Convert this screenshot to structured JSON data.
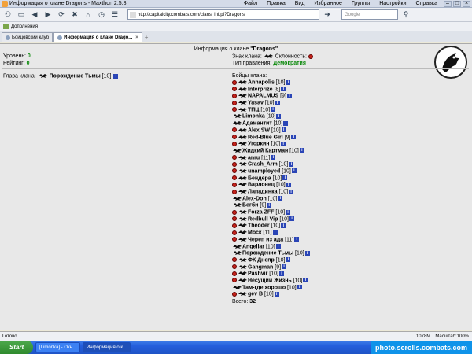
{
  "window": {
    "title": "Информация о клане Dragons - Maxthon 2.5.8",
    "menu": [
      "Файл",
      "Правка",
      "Вид",
      "Избранное",
      "Группы",
      "Настройки",
      "Справка"
    ]
  },
  "toolbar": {
    "address": "http://capitalcity.combats.com/clans_inf.pl?Dragons",
    "search_placeholder": "Google"
  },
  "addons": {
    "label": "Дополнения"
  },
  "tabs": [
    {
      "label": "Бойцовский клуб",
      "active": false
    },
    {
      "label": "Информация о клане Drago...",
      "active": true
    }
  ],
  "clan": {
    "header_prefix": "Информация о клане",
    "name": "\"Dragons\"",
    "level_label": "Уровень:",
    "level": "0",
    "rating_label": "Рейтинг:",
    "rating": "0",
    "sign_label": "Знак клана:",
    "alignment_label": "Склонность:",
    "government_label": "Тип правления:",
    "government": "Демократия",
    "head_label": "Глава клана:",
    "head_name": "Порождение Тьмы",
    "head_level": "[10]",
    "fighters_label": "Бойцы клана:",
    "total_label": "Всего:",
    "total": "32"
  },
  "members": [
    {
      "name": "Annapolis",
      "level": "[10]",
      "emblem": true
    },
    {
      "name": "Interprize",
      "level": "[8]",
      "emblem": true
    },
    {
      "name": "NAPALMUS",
      "level": "[9]",
      "emblem": true
    },
    {
      "name": "Yasav",
      "level": "[10]",
      "emblem": true
    },
    {
      "name": "TПЦ",
      "level": "[10]",
      "emblem": true
    },
    {
      "name": "Limonka",
      "level": "[10]",
      "emblem": false
    },
    {
      "name": "Адамантит",
      "level": "[10]",
      "emblem": false
    },
    {
      "name": "Alex SW",
      "level": "[10]",
      "emblem": true
    },
    {
      "name": "Red-Blue Girl",
      "level": "[9]",
      "emblem": true
    },
    {
      "name": "Угоркин",
      "level": "[10]",
      "emblem": true
    },
    {
      "name": "Жидкий Картман",
      "level": "[10]",
      "emblem": false
    },
    {
      "name": "anru",
      "level": "[11]",
      "emblem": true
    },
    {
      "name": "Crash_Arm",
      "level": "[10]",
      "emblem": true
    },
    {
      "name": "unamployed",
      "level": "[10]",
      "emblem": true
    },
    {
      "name": "Бендера",
      "level": "[10]",
      "emblem": true
    },
    {
      "name": "Варлонец",
      "level": "[10]",
      "emblem": true
    },
    {
      "name": "Лападинка",
      "level": "[10]",
      "emblem": true
    },
    {
      "name": "Alex-Don",
      "level": "[10]",
      "emblem": false
    },
    {
      "name": "Бегби",
      "level": "[9]",
      "emblem": false
    },
    {
      "name": "Forza ZFF",
      "level": "[10]",
      "emblem": true
    },
    {
      "name": "Redbull Vip",
      "level": "[10]",
      "emblem": true
    },
    {
      "name": "Theoder",
      "level": "[10]",
      "emblem": true
    },
    {
      "name": "Моск",
      "level": "[11]",
      "emblem": true
    },
    {
      "name": "Череп из ада",
      "level": "[11]",
      "emblem": true
    },
    {
      "name": "Angellar",
      "level": "[10]",
      "emblem": false
    },
    {
      "name": "Порождение Тьмы",
      "level": "[10]",
      "emblem": false
    },
    {
      "name": "ФК Днепр",
      "level": "[10]",
      "emblem": true
    },
    {
      "name": "Gangman",
      "level": "[9]",
      "emblem": true
    },
    {
      "name": "Pashvir",
      "level": "[10]",
      "emblem": true
    },
    {
      "name": "Несущий Жизнь",
      "level": "[10]",
      "emblem": true
    },
    {
      "name": "Там-где хорошо",
      "level": "[10]",
      "emblem": false
    },
    {
      "name": "gev B",
      "level": "[10]",
      "emblem": true
    }
  ],
  "statusbar": {
    "status": "Готово",
    "memory": "1078M",
    "zoom": "Масштаб:100%"
  },
  "taskbar": {
    "start": "Start",
    "tasks": [
      "[Limonka] - Окн...",
      "Информация о к..."
    ],
    "watermark": "photo.scrolls.combats.com"
  },
  "colors": {
    "green": "#0d8a0d",
    "emblem_red": "#c4221a",
    "info_blue": "#2a45b6"
  }
}
